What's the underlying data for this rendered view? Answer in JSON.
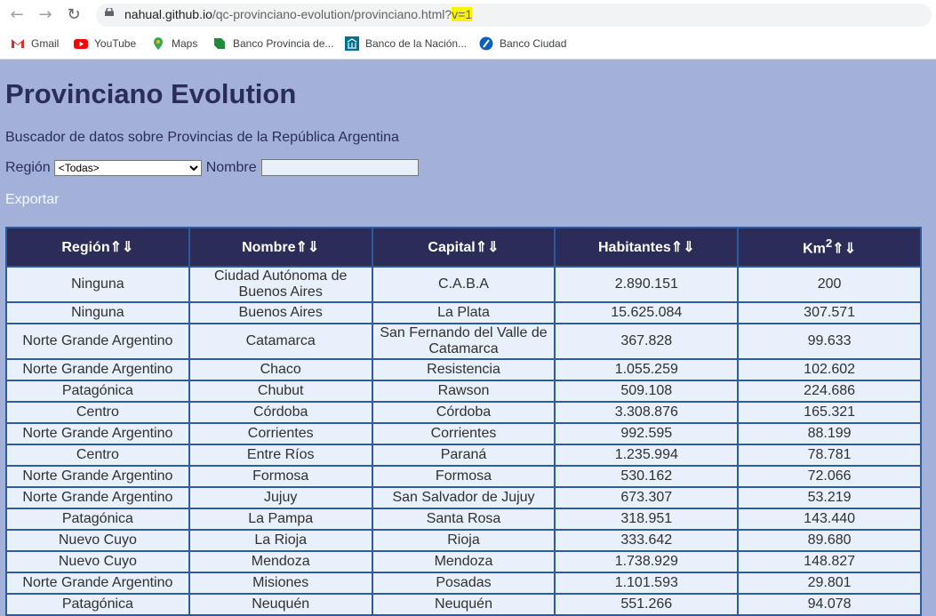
{
  "browser": {
    "url_host": "nahual.github.io",
    "url_path": "/qc-provinciano-evolution/provinciano.html?",
    "url_query": "v=1",
    "bookmarks": [
      "Gmail",
      "YouTube",
      "Maps",
      "Banco Provincia de...",
      "Banco de la Nación...",
      "Banco Ciudad"
    ]
  },
  "page": {
    "title": "Provinciano Evolution",
    "subtitle": "Buscador de datos sobre Provincias de la República Argentina",
    "region_label": "Región",
    "region_selected": "<Todas>",
    "nombre_label": "Nombre",
    "nombre_value": "",
    "export_label": "Exportar"
  },
  "table": {
    "headers": [
      "Región⇑⇓",
      "Nombre⇑⇓",
      "Capital⇑⇓",
      "Habitantes⇑⇓",
      "Km2⇑⇓"
    ],
    "rows": [
      [
        "Ninguna",
        "Ciudad Autónoma de Buenos Aires",
        "C.A.B.A",
        "2.890.151",
        "200"
      ],
      [
        "Ninguna",
        "Buenos Aires",
        "La Plata",
        "15.625.084",
        "307.571"
      ],
      [
        "Norte Grande Argentino",
        "Catamarca",
        "San Fernando del Valle de Catamarca",
        "367.828",
        "99.633"
      ],
      [
        "Norte Grande Argentino",
        "Chaco",
        "Resistencia",
        "1.055.259",
        "102.602"
      ],
      [
        "Patagónica",
        "Chubut",
        "Rawson",
        "509.108",
        "224.686"
      ],
      [
        "Centro",
        "Córdoba",
        "Córdoba",
        "3.308.876",
        "165.321"
      ],
      [
        "Norte Grande Argentino",
        "Corrientes",
        "Corrientes",
        "992.595",
        "88.199"
      ],
      [
        "Centro",
        "Entre Ríos",
        "Paraná",
        "1.235.994",
        "78.781"
      ],
      [
        "Norte Grande Argentino",
        "Formosa",
        "Formosa",
        "530.162",
        "72.066"
      ],
      [
        "Norte Grande Argentino",
        "Jujuy",
        "San Salvador de Jujuy",
        "673.307",
        "53.219"
      ],
      [
        "Patagónica",
        "La Pampa",
        "Santa Rosa",
        "318.951",
        "143.440"
      ],
      [
        "Nuevo Cuyo",
        "La Rioja",
        "Rioja",
        "333.642",
        "89.680"
      ],
      [
        "Nuevo Cuyo",
        "Mendoza",
        "Mendoza",
        "1.738.929",
        "148.827"
      ],
      [
        "Norte Grande Argentino",
        "Misiones",
        "Posadas",
        "1.101.593",
        "29.801"
      ],
      [
        "Patagónica",
        "Neuquén",
        "Neuquén",
        "551.266",
        "94.078"
      ]
    ]
  }
}
